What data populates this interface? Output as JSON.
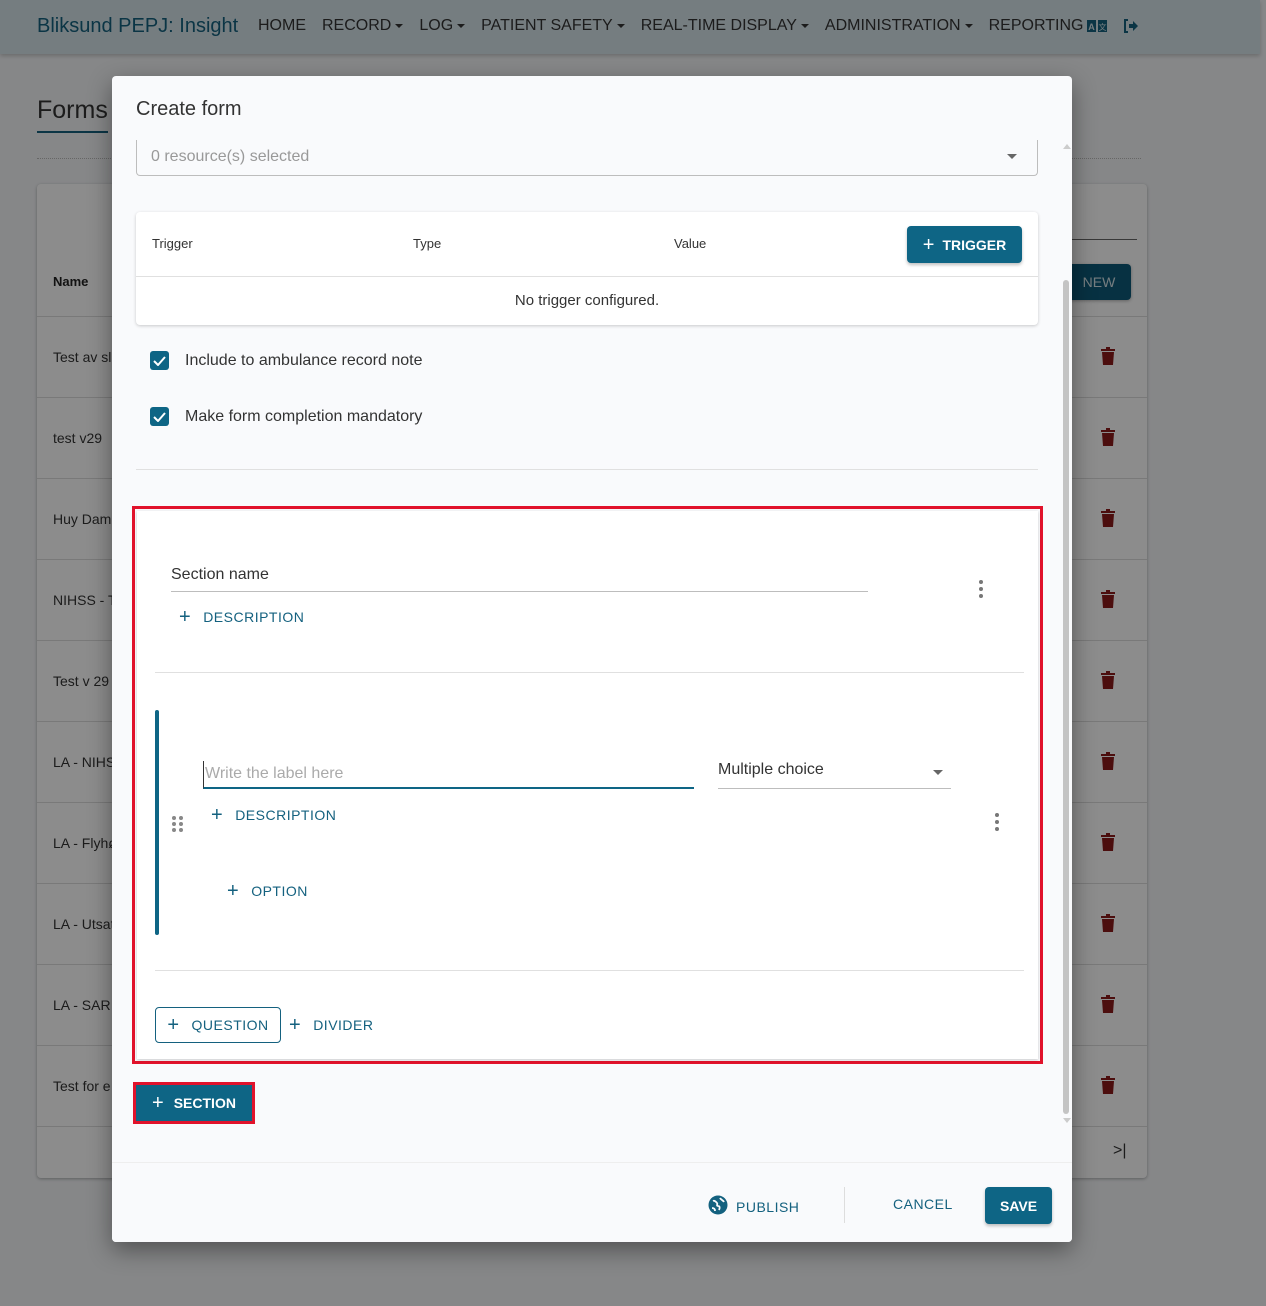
{
  "navbar": {
    "brand": "Bliksund PEPJ: Insight",
    "items": [
      {
        "label": "HOME",
        "dropdown": false
      },
      {
        "label": "RECORD",
        "dropdown": true
      },
      {
        "label": "LOG",
        "dropdown": true
      },
      {
        "label": "PATIENT SAFETY",
        "dropdown": true
      },
      {
        "label": "REAL-TIME DISPLAY",
        "dropdown": true
      },
      {
        "label": "ADMINISTRATION",
        "dropdown": true
      },
      {
        "label": "REPORTING",
        "dropdown": true
      }
    ],
    "icons": [
      "translate-icon",
      "logout-icon"
    ]
  },
  "page": {
    "title": "Forms",
    "new_button": "NEW",
    "column_name": "Name",
    "rows": [
      "Test av sl",
      "test v29",
      "Huy Dam",
      "NIHSS - T",
      "Test v 29",
      "LA - NIHS",
      "LA - Flyhø",
      "LA - Utsat",
      "LA - SAR",
      "Test for e"
    ],
    "pager_last": ">|"
  },
  "modal": {
    "title": "Create form",
    "resource_select": {
      "value": "0 resource(s) selected"
    },
    "triggers": {
      "headers": [
        "Trigger",
        "Type",
        "Value"
      ],
      "add_button": "TRIGGER",
      "empty_text": "No trigger configured."
    },
    "checkboxes": [
      {
        "label": "Include to ambulance record note",
        "checked": true
      },
      {
        "label": "Make form completion mandatory",
        "checked": true
      }
    ],
    "section": {
      "name_value": "Section name",
      "add_description": "DESCRIPTION",
      "question": {
        "label_placeholder": "Write the label here",
        "type_value": "Multiple choice",
        "add_description": "DESCRIPTION",
        "add_option": "OPTION"
      },
      "add_question": "QUESTION",
      "add_divider": "DIVIDER"
    },
    "add_section": "SECTION",
    "footer": {
      "publish": "PUBLISH",
      "cancel": "CANCEL",
      "save": "SAVE"
    }
  },
  "colors": {
    "primary": "#0e6585",
    "highlight": "#e1122b",
    "delete": "#8b1a1a"
  }
}
